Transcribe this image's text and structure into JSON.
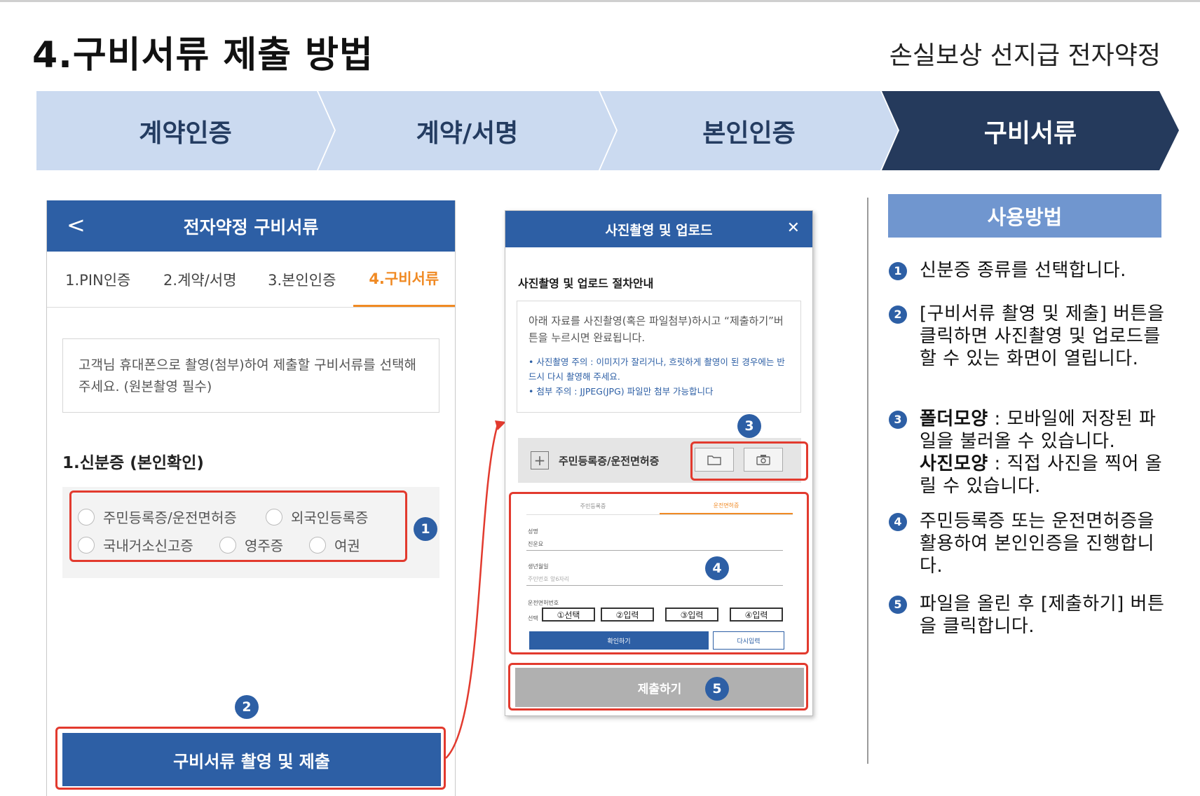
{
  "page": {
    "title": "4.구비서류 제출 방법",
    "subtitle": "손실보상 선지급 전자약정"
  },
  "steps": [
    {
      "label": "계약인증",
      "active": false
    },
    {
      "label": "계약/서명",
      "active": false
    },
    {
      "label": "본인인증",
      "active": false
    },
    {
      "label": "구비서류",
      "active": true
    }
  ],
  "colors": {
    "step_inactive": "#cbdaf0",
    "step_active": "#253a5c",
    "brand_blue": "#2d5fa5",
    "accent_orange": "#f08a24",
    "highlight_red": "#e23a2e",
    "usage_head": "#7096cf"
  },
  "phone": {
    "back_icon": "chevron-left-icon",
    "header_title": "전자약정 구비서류",
    "tabs": [
      "1.PIN인증",
      "2.계약/서명",
      "3.본인인증",
      "4.구비서류"
    ],
    "active_tab_index": 3,
    "info_text": "고객님 휴대폰으로 촬영(첨부)하여 제출할 구비서류를 선택해 주세요. (원본촬영 필수)",
    "section_label": "1.신분증 (본인확인)",
    "radios": [
      "주민등록증/운전면허증",
      "외국인등록증",
      "국내거소신고증",
      "영주증",
      "여권"
    ],
    "submit_label": "구비서류 촬영 및 제출"
  },
  "modal": {
    "header_title": "사진촬영 및 업로드",
    "close_icon": "close-icon",
    "guide_title": "사진촬영 및 업로드 절차안내",
    "guide_text": "아래 자료를 사진촬영(혹은 파일첨부)하시고 “제출하기”버튼을 누르시면 완료됩니다.",
    "note1": "• 사진촬영 주의 : 이미지가 잘리거나, 흐릿하게 촬영이 된 경우에는 반드시 다시 촬영해 주세요.",
    "note2": "• 첨부 주의 : JJPEG(JPG) 파일만 첨부 가능합니다",
    "upload_label": "주민등록증/운전면허증",
    "folder_icon": "folder-icon",
    "camera_icon": "camera-icon",
    "form_tabs": [
      "주민등록증",
      "운전면허증"
    ],
    "field_name_label": "성명",
    "field_name_value": "진운요",
    "field_birth_label": "생년월일",
    "field_birth_placeholder": "주민번호 앞6자리",
    "field_license_label": "운전면허번호",
    "field_select_label": "선택",
    "license_boxes": [
      "①선택",
      "②입력",
      "③입력",
      "④입력"
    ],
    "confirm_label": "확인하기",
    "reset_label": "다시입력",
    "submit_label": "제출하기"
  },
  "badges": [
    "1",
    "2",
    "3",
    "4",
    "5"
  ],
  "usage": {
    "title": "사용방법",
    "items": [
      {
        "num": "1",
        "text": "신분증 종류를 선택합니다."
      },
      {
        "num": "2",
        "text": "[구비서류 촬영 및 제출] 버튼을 클릭하면 사진촬영 및 업로드를 할 수 있는 화면이 열립니다."
      },
      {
        "num": "3",
        "bold1": "폴더모양",
        "text1": " : 모바일에 저장된 파일을 불러올 수 있습니다.",
        "bold2": "사진모양",
        "text2": " : 직접 사진을 찍어 올릴 수 있습니다."
      },
      {
        "num": "4",
        "text": "주민등록증 또는 운전면허증을 활용하여 본인인증을 진행합니다."
      },
      {
        "num": "5",
        "text": "파일을 올린 후 [제출하기] 버튼을 클릭합니다."
      }
    ]
  }
}
